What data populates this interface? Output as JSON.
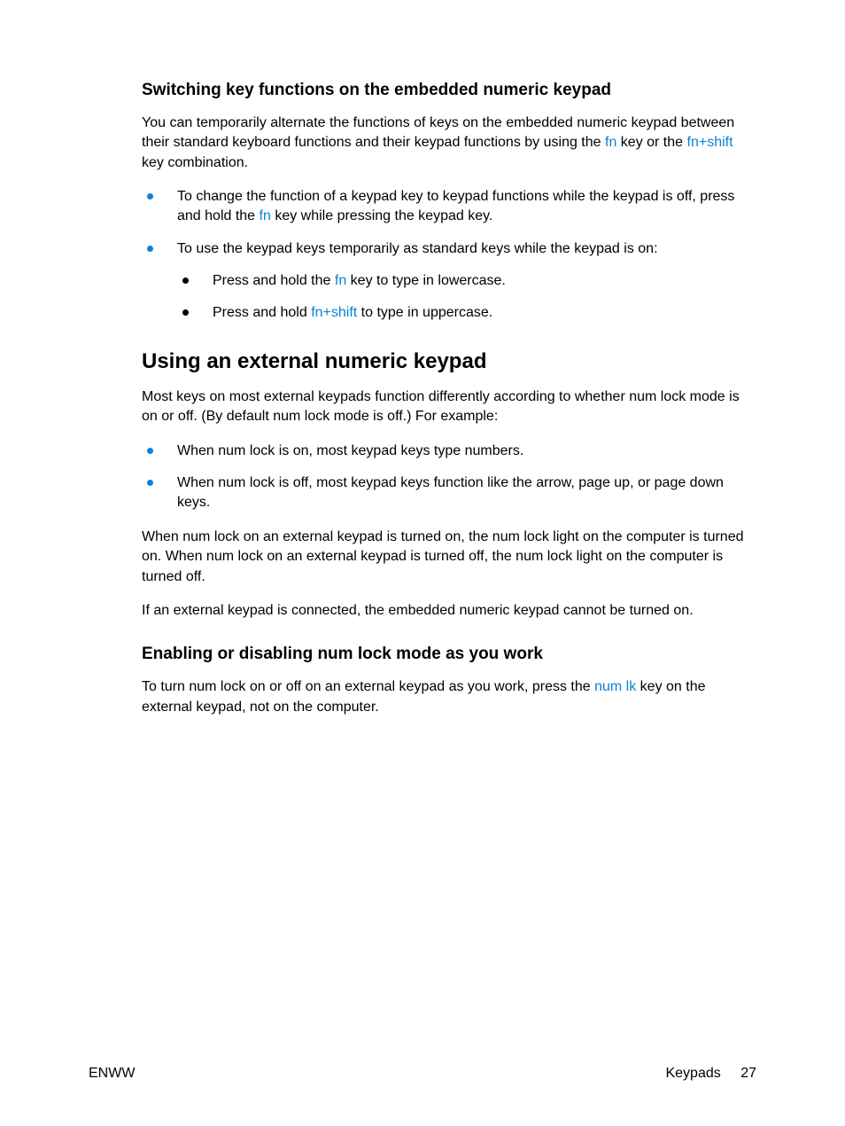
{
  "section1": {
    "heading": "Switching key functions on the embedded numeric keypad",
    "para1_a": "You can temporarily alternate the functions of keys on the embedded numeric keypad between their standard keyboard functions and their keypad functions by using the ",
    "para1_key1": "fn",
    "para1_b": " key or the ",
    "para1_key2": "fn+shift",
    "para1_c": " key combination.",
    "bullet1_a": "To change the function of a keypad key to keypad functions while the keypad is off, press and hold the ",
    "bullet1_key": "fn",
    "bullet1_b": " key while pressing the keypad key.",
    "bullet2": "To use the keypad keys temporarily as standard keys while the keypad is on:",
    "sub1_a": "Press and hold the ",
    "sub1_key": "fn",
    "sub1_b": " key to type in lowercase.",
    "sub2_a": "Press and hold ",
    "sub2_key": "fn+shift",
    "sub2_b": " to type in uppercase."
  },
  "section2": {
    "heading": "Using an external numeric keypad",
    "para1": "Most keys on most external keypads function differently according to whether num lock mode is on or off. (By default num lock mode is off.) For example:",
    "bullet1": "When num lock is on, most keypad keys type numbers.",
    "bullet2": "When num lock is off, most keypad keys function like the arrow, page up, or page down keys.",
    "para2": "When num lock on an external keypad is turned on, the num lock light on the computer is turned on. When num lock on an external keypad is turned off, the num lock light on the computer is turned off.",
    "para3": "If an external keypad is connected, the embedded numeric keypad cannot be turned on."
  },
  "section3": {
    "heading": "Enabling or disabling num lock mode as you work",
    "para1_a": "To turn num lock on or off on an external keypad as you work, press the ",
    "para1_key": "num lk",
    "para1_b": " key on the external keypad, not on the computer."
  },
  "footer": {
    "left": "ENWW",
    "right_label": "Keypads",
    "page": "27"
  }
}
